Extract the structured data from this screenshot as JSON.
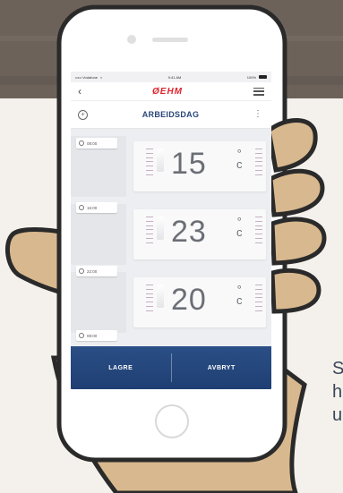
{
  "status_bar": {
    "carrier": "••••• Vodafone",
    "time": "9:41 AM",
    "battery": "100%"
  },
  "nav": {
    "back_label": "‹",
    "brand": "ØEHM"
  },
  "day_header": {
    "title": "ARBEIDSDAG",
    "more_label": "⋮",
    "add_label": "+"
  },
  "schedule": {
    "times": [
      "08:00",
      "16:00",
      "22:00",
      "08:00"
    ],
    "rows": [
      {
        "temperature": "15",
        "unit_top": "°",
        "unit_bottom": "c"
      },
      {
        "temperature": "23",
        "unit_top": "°",
        "unit_bottom": "c"
      },
      {
        "temperature": "20",
        "unit_top": "°",
        "unit_bottom": "c"
      }
    ]
  },
  "footer": {
    "save_label": "LAGRE",
    "cancel_label": "AVBRYT"
  },
  "side_text": [
    "S",
    "h",
    "u"
  ],
  "colors": {
    "brand_red": "#e0222c",
    "footer_blue": "#23477c",
    "title_blue": "#29467a"
  }
}
